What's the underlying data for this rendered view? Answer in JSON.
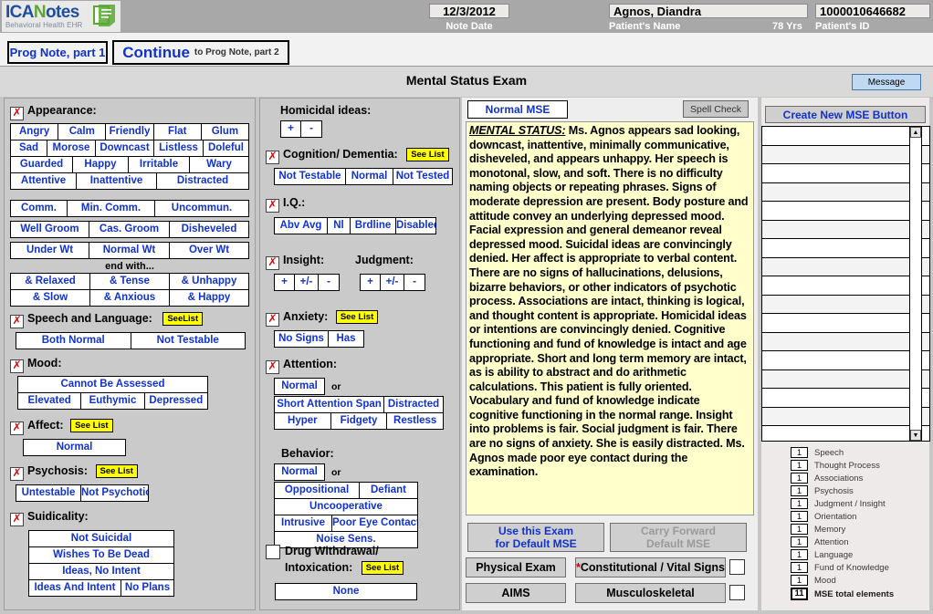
{
  "brand": {
    "logo_ica": "ICA",
    "logo_n": "N",
    "logo_otes": "otes",
    "tagline": "Behavioral Health EHR"
  },
  "header": {
    "note_date": "12/3/2012",
    "note_date_label": "Note Date",
    "patient_name": "Agnos, Diandra",
    "patient_name_label": "Patient's Name",
    "age": "78 Yrs",
    "patient_id": "1000010646682",
    "patient_id_label": "Patient's ID"
  },
  "nav": {
    "prog_note": "Prog Note, part 1",
    "continue_big": "Continue",
    "continue_small": "to Prog Note, part 2"
  },
  "title": {
    "page_title": "Mental Status Exam",
    "message_button": "Message"
  },
  "left": {
    "appearance": {
      "label": "Appearance:",
      "rows": [
        [
          "Angry",
          "Calm",
          "Friendly",
          "Flat",
          "Glum"
        ],
        [
          "Sad",
          "Morose",
          "Downcast",
          "Listless",
          "Doleful"
        ],
        [
          "Guarded",
          "Happy",
          "Irritable",
          "Wary"
        ],
        [
          "Attentive",
          "Inattentive",
          "Distracted"
        ]
      ],
      "comm_row": [
        "Comm.",
        "Min. Comm.",
        "Uncommun."
      ],
      "groom_row": [
        "Well Groom",
        "Cas. Groom",
        "Disheveled"
      ],
      "weight_row": [
        "Under Wt",
        "Normal Wt",
        "Over Wt"
      ],
      "end_with_label": "end with...",
      "end_rows": [
        [
          "& Relaxed",
          "& Tense",
          "& Unhappy"
        ],
        [
          "& Slow",
          "& Anxious",
          "& Happy"
        ]
      ]
    },
    "speech": {
      "label": "Speech and Language:",
      "see_list": "SeeList",
      "options": [
        "Both Normal",
        "Not Testable"
      ]
    },
    "mood": {
      "label": "Mood:",
      "full": "Cannot Be Assessed",
      "options": [
        "Elevated",
        "Euthymic",
        "Depressed"
      ]
    },
    "affect": {
      "label": "Affect:",
      "see_list": "See List",
      "options": [
        "Normal"
      ]
    },
    "psychosis": {
      "label": "Psychosis:",
      "see_list": "See List",
      "options": [
        "Untestable",
        "Not Psychotic"
      ]
    },
    "suicidality": {
      "label": "Suidicality:",
      "rows": [
        [
          "Not Suicidal"
        ],
        [
          "Wishes To Be Dead"
        ],
        [
          "Ideas, No Intent"
        ],
        [
          "Ideas And Intent",
          "No Plans"
        ]
      ]
    }
  },
  "mid": {
    "homicidal": {
      "label": "Homicidal ideas:",
      "options": [
        "+",
        "-"
      ]
    },
    "cognition": {
      "label": "Cognition/ Dementia:",
      "see_list": "See List",
      "options": [
        "Not Testable",
        "Normal",
        "Not Tested"
      ]
    },
    "iq": {
      "label": "I.Q.:",
      "options": [
        "Abv Avg",
        "Nl",
        "Brdline",
        "Disabled."
      ]
    },
    "insight": {
      "label": "Insight:",
      "options": [
        "+",
        "+/-",
        "-"
      ]
    },
    "judgment": {
      "label": "Judgment:",
      "options": [
        "+",
        "+/-",
        "-"
      ]
    },
    "anxiety": {
      "label": "Anxiety:",
      "see_list": "See List",
      "options": [
        "No Signs",
        "Has"
      ]
    },
    "attention": {
      "label": "Attention:",
      "normal": "Normal",
      "or": "or",
      "rows": [
        [
          "Short Attention Span",
          "Distracted"
        ],
        [
          "Hyper",
          "Fidgety",
          "Restless"
        ]
      ]
    },
    "behavior": {
      "label": "Behavior:",
      "normal": "Normal",
      "or": "or",
      "rows": [
        [
          "Oppositional",
          "Defiant"
        ],
        [
          "Uncooperative"
        ],
        [
          "Intrusive",
          "Poor Eye Contact"
        ],
        [
          "Noise Sens."
        ]
      ]
    },
    "drug": {
      "label_line1": "Drug Withdrawal/",
      "label_line2": "Intoxication:",
      "see_list": "See List",
      "options": [
        "None"
      ]
    }
  },
  "note": {
    "normal_mse_button": "Normal MSE",
    "spell_check_button": "Spell Check",
    "heading": "MENTAL STATUS:",
    "body": "  Ms. Agnos appears sad looking,  downcast,  inattentive, minimally communicative, disheveled,  and appears unhappy. Her speech is  monotonal, slow, and soft. There is no difficulty naming objects or repeating phrases. Signs of moderate depression are present.   Body posture and attitude convey an underlying depressed mood. Facial expression and general demeanor reveal depressed mood.   Suicidal ideas are convincingly denied.  Her affect is appropriate to verbal content.   There are no signs of hallucinations, delusions, bizarre behaviors, or other indicators of psychotic process. Associations are intact, thinking is logical, and thought content is appropriate.   Homicidal ideas or intentions are convincingly denied.   Cognitive functioning and fund of knowledge is intact and age appropriate.  Short and long term memory are intact, as is ability to abstract and do arithmetic calculations. This patient is fully oriented. Vocabulary and fund of knowledge indicate cognitive functioning in the normal range. Insight into problems is fair.  Social judgment is fair. There are no signs of anxiety. She is easily distracted. Ms. Agnos made poor eye contact during the examination.",
    "use_exam_line1": "Use this Exam",
    "use_exam_line2": "for Default MSE",
    "carry_line1": "Carry Forward",
    "carry_line2": "Default MSE",
    "physical_exam": "Physical Exam",
    "constitutional": "Constitutional / Vital Signs",
    "constitutional_star": "*",
    "aims": "AIMS",
    "musculoskeletal": "Musculoskeletal"
  },
  "right": {
    "create_button": "Create New MSE Button",
    "list_rows": [
      "",
      "",
      "",
      "",
      "",
      "",
      "",
      "",
      "",
      "",
      "",
      "",
      "",
      "",
      "",
      "",
      ""
    ],
    "counters": [
      {
        "count": "1",
        "label": "Speech"
      },
      {
        "count": "1",
        "label": "Thought Process"
      },
      {
        "count": "1",
        "label": "Associations"
      },
      {
        "count": "1",
        "label": "Psychosis"
      },
      {
        "count": "1",
        "label": "Judgment / Insight"
      },
      {
        "count": "1",
        "label": "Orientation"
      },
      {
        "count": "1",
        "label": "Memory"
      },
      {
        "count": "1",
        "label": "Attention"
      },
      {
        "count": "1",
        "label": "Language"
      },
      {
        "count": "1",
        "label": "Fund of Knowledge"
      },
      {
        "count": "1",
        "label": "Mood"
      }
    ],
    "total": {
      "count": "11",
      "label": "MSE total elements"
    }
  },
  "colors": {
    "accent_blue": "#1133cc",
    "highlight_yellow": "#ffff00",
    "note_bg": "#ffffcc",
    "red_x": "#e00000"
  }
}
